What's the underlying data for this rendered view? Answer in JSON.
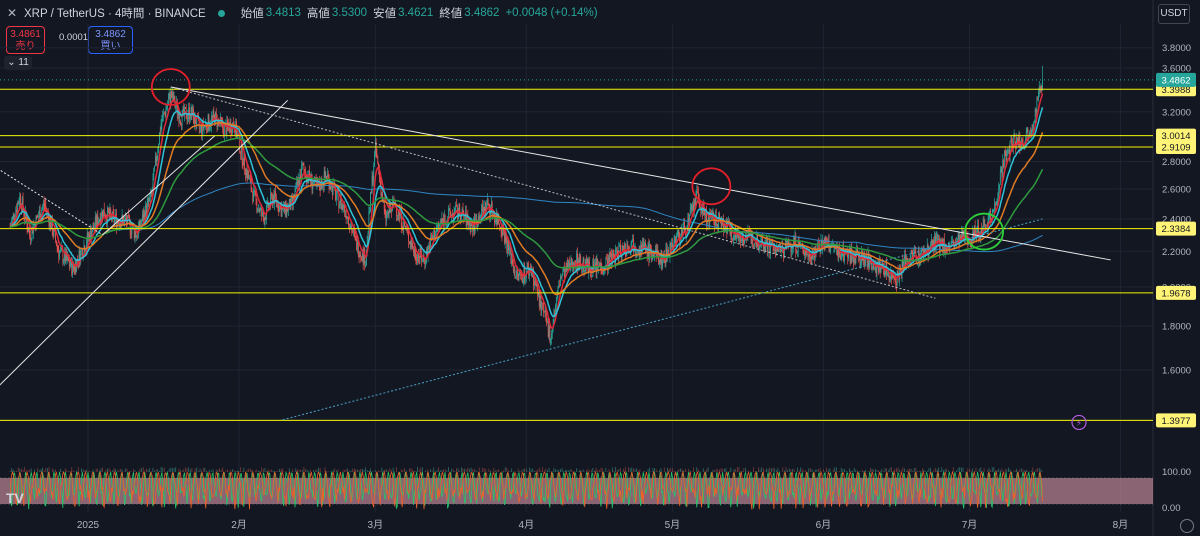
{
  "header": {
    "symbol": "XRP / TetherUS · 4時間 · BINANCE",
    "open_label": "始値",
    "open": "3.4813",
    "high_label": "高値",
    "high": "3.5300",
    "low_label": "安値",
    "low": "3.4621",
    "close_label": "終値",
    "close": "3.4862",
    "change": "+0.0048 (+0.14%)"
  },
  "trade": {
    "sell_price": "3.4861",
    "sell_label": "売り",
    "spread": "0.0001",
    "buy_price": "3.4862",
    "buy_label": "買い",
    "indicator_count": "11"
  },
  "currency": "USDT",
  "colors": {
    "background": "#131722",
    "up": "#26a69a",
    "down": "#ef5350",
    "level_line": "#f5f500",
    "grid": "#1f2433"
  },
  "chart_data": {
    "type": "candlestick",
    "y_scale": "log",
    "ylim": [
      1.25,
      4.05
    ],
    "y_ticks": [
      "3.8000",
      "3.6000",
      "3.4000",
      "3.2000",
      "3.0000",
      "2.8000",
      "2.6000",
      "2.4000",
      "2.2000",
      "2.0000",
      "1.8000",
      "1.6000",
      "1.4000"
    ],
    "x_ticks": [
      {
        "label": "2025",
        "day": 0
      },
      {
        "label": "2月",
        "day": 31
      },
      {
        "label": "3月",
        "day": 59
      },
      {
        "label": "4月",
        "day": 90
      },
      {
        "label": "5月",
        "day": 120
      },
      {
        "label": "6月",
        "day": 151
      },
      {
        "label": "7月",
        "day": 181
      },
      {
        "label": "8月",
        "day": 212
      }
    ],
    "price_path": [
      {
        "day": -16,
        "price": 2.35
      },
      {
        "day": -14,
        "price": 2.55
      },
      {
        "day": -12,
        "price": 2.3
      },
      {
        "day": -9,
        "price": 2.5
      },
      {
        "day": -6,
        "price": 2.2
      },
      {
        "day": -3,
        "price": 2.1
      },
      {
        "day": 0,
        "price": 2.28
      },
      {
        "day": 3,
        "price": 2.45
      },
      {
        "day": 5,
        "price": 2.4
      },
      {
        "day": 8,
        "price": 2.38
      },
      {
        "day": 10,
        "price": 2.3
      },
      {
        "day": 13,
        "price": 2.55
      },
      {
        "day": 15,
        "price": 3.1
      },
      {
        "day": 17,
        "price": 3.35
      },
      {
        "day": 19,
        "price": 3.15
      },
      {
        "day": 21,
        "price": 3.2
      },
      {
        "day": 23,
        "price": 3.05
      },
      {
        "day": 26,
        "price": 3.15
      },
      {
        "day": 28,
        "price": 3.05
      },
      {
        "day": 30,
        "price": 3.1
      },
      {
        "day": 32,
        "price": 2.8
      },
      {
        "day": 34,
        "price": 2.55
      },
      {
        "day": 36,
        "price": 2.4
      },
      {
        "day": 38,
        "price": 2.55
      },
      {
        "day": 40,
        "price": 2.45
      },
      {
        "day": 42,
        "price": 2.5
      },
      {
        "day": 44,
        "price": 2.75
      },
      {
        "day": 47,
        "price": 2.6
      },
      {
        "day": 49,
        "price": 2.7
      },
      {
        "day": 51,
        "price": 2.55
      },
      {
        "day": 53,
        "price": 2.45
      },
      {
        "day": 55,
        "price": 2.25
      },
      {
        "day": 57,
        "price": 2.15
      },
      {
        "day": 59,
        "price": 2.9
      },
      {
        "day": 61,
        "price": 2.4
      },
      {
        "day": 63,
        "price": 2.5
      },
      {
        "day": 65,
        "price": 2.35
      },
      {
        "day": 67,
        "price": 2.2
      },
      {
        "day": 69,
        "price": 2.15
      },
      {
        "day": 71,
        "price": 2.3
      },
      {
        "day": 73,
        "price": 2.4
      },
      {
        "day": 76,
        "price": 2.45
      },
      {
        "day": 79,
        "price": 2.35
      },
      {
        "day": 82,
        "price": 2.5
      },
      {
        "day": 85,
        "price": 2.35
      },
      {
        "day": 88,
        "price": 2.05
      },
      {
        "day": 91,
        "price": 2.1
      },
      {
        "day": 93,
        "price": 1.9
      },
      {
        "day": 95,
        "price": 1.75
      },
      {
        "day": 97,
        "price": 2.05
      },
      {
        "day": 100,
        "price": 2.15
      },
      {
        "day": 103,
        "price": 2.1
      },
      {
        "day": 106,
        "price": 2.12
      },
      {
        "day": 109,
        "price": 2.2
      },
      {
        "day": 112,
        "price": 2.25
      },
      {
        "day": 115,
        "price": 2.2
      },
      {
        "day": 118,
        "price": 2.15
      },
      {
        "day": 120,
        "price": 2.25
      },
      {
        "day": 123,
        "price": 2.35
      },
      {
        "day": 125,
        "price": 2.55
      },
      {
        "day": 127,
        "price": 2.4
      },
      {
        "day": 130,
        "price": 2.38
      },
      {
        "day": 133,
        "price": 2.3
      },
      {
        "day": 136,
        "price": 2.28
      },
      {
        "day": 139,
        "price": 2.25
      },
      {
        "day": 142,
        "price": 2.2
      },
      {
        "day": 145,
        "price": 2.25
      },
      {
        "day": 148,
        "price": 2.18
      },
      {
        "day": 151,
        "price": 2.25
      },
      {
        "day": 154,
        "price": 2.2
      },
      {
        "day": 157,
        "price": 2.18
      },
      {
        "day": 160,
        "price": 2.15
      },
      {
        "day": 163,
        "price": 2.1
      },
      {
        "day": 166,
        "price": 2.05
      },
      {
        "day": 168,
        "price": 2.15
      },
      {
        "day": 171,
        "price": 2.18
      },
      {
        "day": 174,
        "price": 2.25
      },
      {
        "day": 177,
        "price": 2.22
      },
      {
        "day": 180,
        "price": 2.28
      },
      {
        "day": 183,
        "price": 2.32
      },
      {
        "day": 186,
        "price": 2.45
      },
      {
        "day": 188,
        "price": 2.8
      },
      {
        "day": 190,
        "price": 2.95
      },
      {
        "day": 192,
        "price": 2.95
      },
      {
        "day": 194,
        "price": 3.1
      },
      {
        "day": 196,
        "price": 3.4862
      }
    ],
    "horizontal_levels": [
      "3.3988",
      "3.0014",
      "2.9109",
      "2.3384",
      "1.9678",
      "1.3977"
    ],
    "last_price": "3.4862",
    "trendlines": [
      {
        "x1": -20,
        "y1": 2.78,
        "x2": 3,
        "y2": 2.3,
        "color": "#e8e8e8",
        "dash": true
      },
      {
        "x1": 3,
        "y1": 2.3,
        "x2": 26,
        "y2": 3.0,
        "color": "#e8e8e8",
        "dash": false
      },
      {
        "x1": 17,
        "y1": 3.42,
        "x2": 210,
        "y2": 2.15,
        "color": "#e8e8e8",
        "dash": false
      },
      {
        "x1": 17,
        "y1": 3.42,
        "x2": 174,
        "y2": 1.94,
        "color": "#bdbdbd",
        "dash": true
      },
      {
        "x1": -20,
        "y1": 1.5,
        "x2": 41,
        "y2": 3.3,
        "color": "#e8e8e8",
        "dash": false
      },
      {
        "x1": 40,
        "y1": 1.4,
        "x2": 196,
        "y2": 2.4,
        "color": "#4aa3c8",
        "dash": true
      }
    ],
    "circles": [
      {
        "day": 17,
        "price": 3.42,
        "color": "#e5202a"
      },
      {
        "day": 128,
        "price": 2.62,
        "color": "#e5202a"
      },
      {
        "day": 184,
        "price": 2.32,
        "color": "#2ed03a"
      }
    ]
  }
}
